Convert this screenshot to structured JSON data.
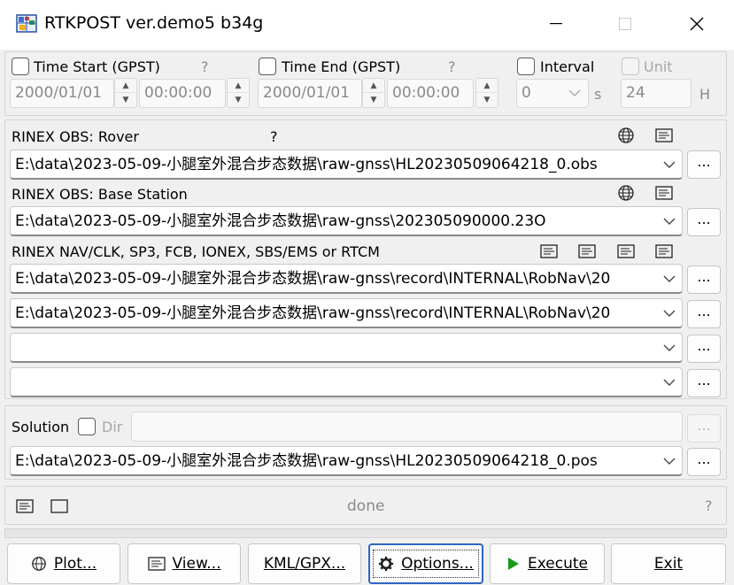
{
  "window": {
    "title": "RTKPOST ver.demo5 b34g",
    "minimize_glyph": "—",
    "maximize_glyph": "☐",
    "close_glyph": "✕"
  },
  "time": {
    "start_label": "Time Start (GPST)",
    "start_help": "?",
    "start_date": "2000/01/01",
    "start_time": "00:00:00",
    "end_label": "Time End (GPST)",
    "end_help": "?",
    "end_date": "2000/01/01",
    "end_time": "00:00:00",
    "interval_label": "Interval",
    "interval_value": "0",
    "interval_unit": "s",
    "unit_label": "Unit",
    "unit_value": "24",
    "unit_unit": "H"
  },
  "inputs": {
    "rover_label": "RINEX OBS: Rover",
    "rover_help": "?",
    "rover_path": "E:\\data\\2023-05-09-小腿室外混合步态数据\\raw-gnss\\HL20230509064218_0.obs",
    "base_label": "RINEX OBS: Base Station",
    "base_path": "E:\\data\\2023-05-09-小腿室外混合步态数据\\raw-gnss\\202305090000.23O",
    "nav_label": "RINEX NAV/CLK, SP3, FCB, IONEX, SBS/EMS  or RTCM",
    "nav_path_1": "E:\\data\\2023-05-09-小腿室外混合步态数据\\raw-gnss\\record\\INTERNAL\\RobNav\\20",
    "nav_path_2": "E:\\data\\2023-05-09-小腿室外混合步态数据\\raw-gnss\\record\\INTERNAL\\RobNav\\20",
    "nav_path_3": "",
    "nav_path_4": "",
    "browse_label": "..."
  },
  "solution": {
    "label": "Solution",
    "dir_label": "Dir",
    "dir_value": "",
    "path": "E:\\data\\2023-05-09-小腿室外混合步态数据\\raw-gnss\\HL20230509064218_0.pos",
    "browse_label": "..."
  },
  "status": {
    "message": "done",
    "help": "?"
  },
  "buttons": {
    "plot": "Plot...",
    "view": "View...",
    "kml": "KML/GPX...",
    "options": "Options...",
    "execute": "Execute",
    "exit": "Exit"
  },
  "colors": {
    "focus_border": "#2b66c4",
    "execute_icon": "#1a9a1a",
    "background": "#f0f0f0"
  },
  "icons": [
    "app-icon",
    "globe-icon",
    "text-viewer-icon",
    "chevron-down-icon",
    "gear-icon",
    "play-icon",
    "plot-icon"
  ]
}
